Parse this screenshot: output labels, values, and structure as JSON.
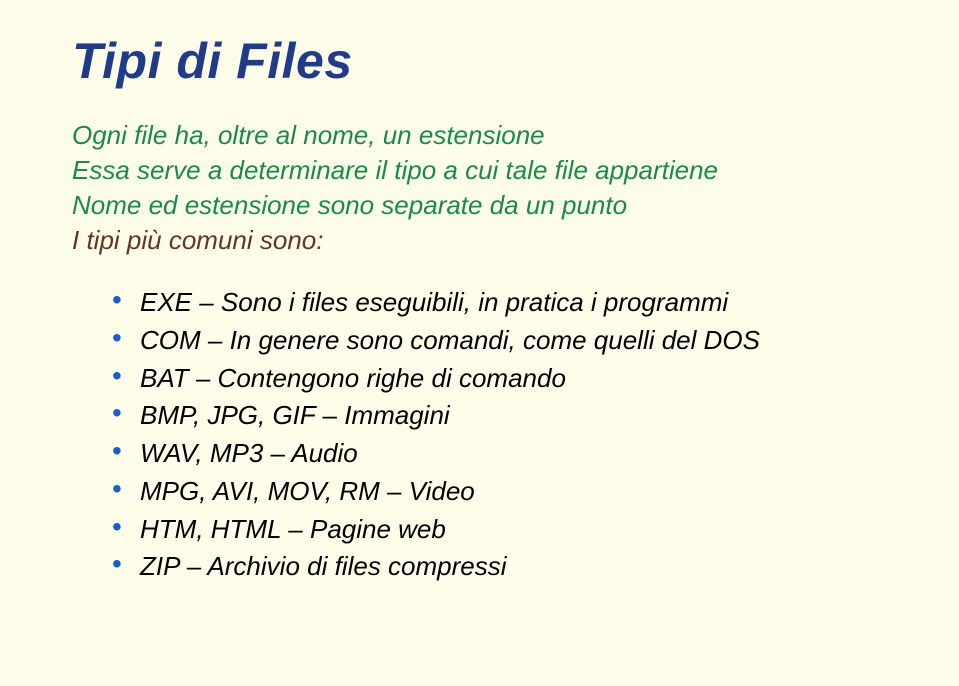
{
  "title": "Tipi di Files",
  "intro": {
    "line1": "Ogni file ha, oltre al nome, un estensione",
    "line2": "Essa serve a determinare il tipo a cui tale file appartiene",
    "line3": "Nome ed estensione sono separate da un punto",
    "line4": "I tipi più comuni sono:"
  },
  "items": [
    "EXE – Sono i files eseguibili, in pratica i programmi",
    "COM – In genere sono comandi, come quelli del DOS",
    "BAT – Contengono righe di comando",
    "BMP, JPG, GIF – Immagini",
    "WAV, MP3  – Audio",
    "MPG, AVI, MOV, RM – Video",
    "HTM, HTML – Pagine web",
    "ZIP – Archivio di files compressi"
  ]
}
